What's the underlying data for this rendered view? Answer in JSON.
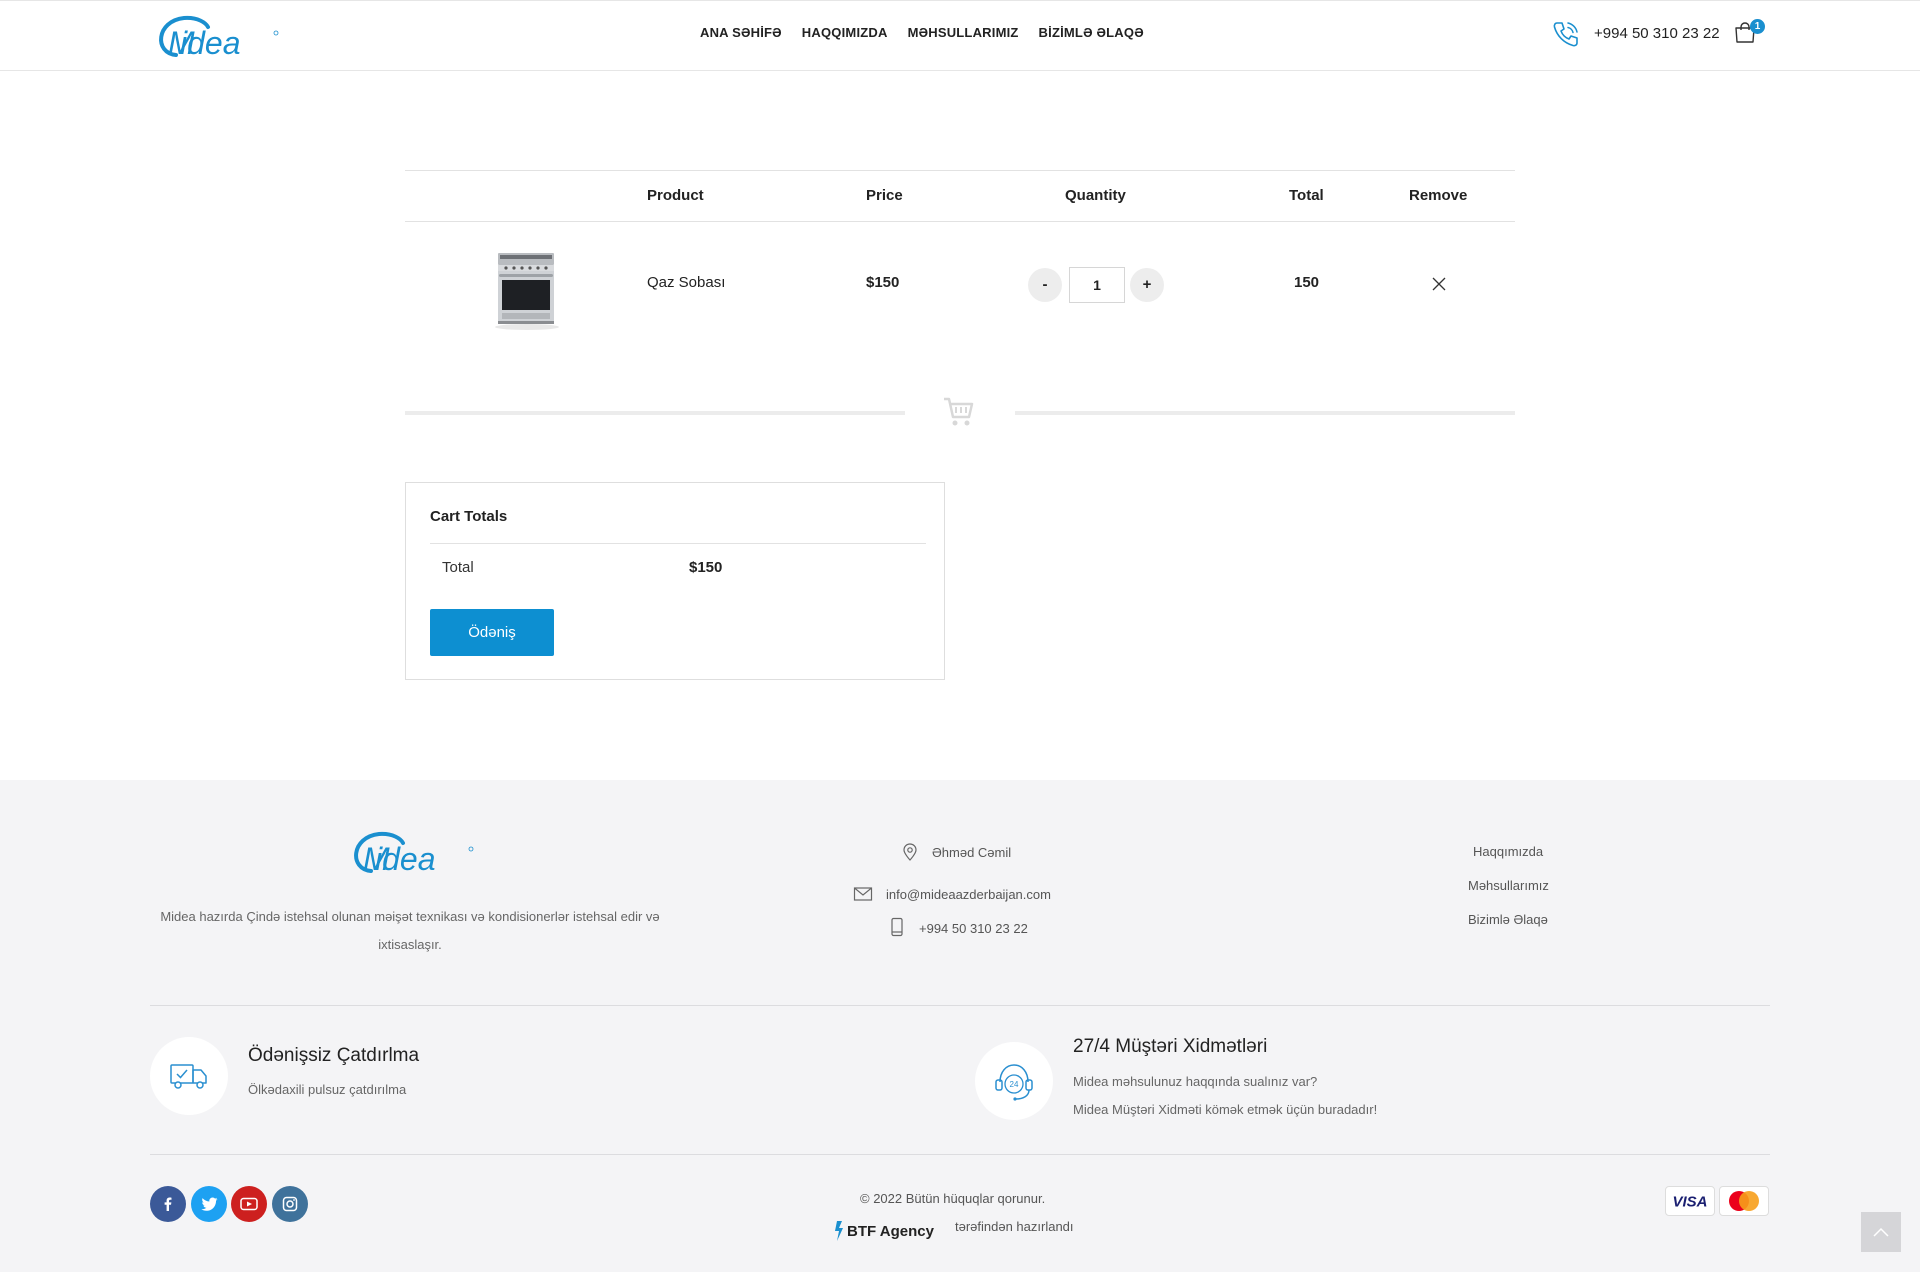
{
  "brand": {
    "name": "Midea",
    "accent": "#0d8fd1"
  },
  "nav": {
    "items": [
      {
        "label": "ANA SƏHİFƏ"
      },
      {
        "label": "HAQQIMIZDA"
      },
      {
        "label": "MƏHSULLARIMIZ"
      },
      {
        "label": "BİZİMLƏ ƏLAQƏ"
      }
    ],
    "phone": "+994 50 310 23 22",
    "cart_count": "1"
  },
  "cart": {
    "headers": {
      "product": "Product",
      "price": "Price",
      "quantity": "Quantity",
      "total": "Total",
      "remove": "Remove"
    },
    "items": [
      {
        "name": "Qaz Sobası",
        "price": "$150",
        "quantity": "1",
        "total": "150",
        "minus": "-",
        "plus": "+"
      }
    ]
  },
  "totals": {
    "title": "Cart Totals",
    "label": "Total",
    "value": "$150",
    "button": "Ödəniş"
  },
  "footer": {
    "description": "Midea hazırda Çində istehsal olunan məişət texnikası və kondisionerlər istehsal edir və ixtisaslaşır.",
    "address": "Əhməd Cəmil",
    "email": "info@mideaazderbaijan.com",
    "phone": "+994 50 310 23 22",
    "links": [
      {
        "label": "Haqqımızda"
      },
      {
        "label": "Məhsullarımız"
      },
      {
        "label": "Bizimlə Əlaqə"
      }
    ],
    "features": [
      {
        "title": "Ödənişsiz Çatdırlma",
        "text": "Ölkədaxili pulsuz çatdırılma"
      },
      {
        "title": "27/4 Müştəri Xidmətləri",
        "text1": "Midea məhsulunuz haqqında sualınız var?",
        "text2": "Midea Müştəri Xidməti kömək etmək üçün buradadır!"
      }
    ],
    "copyright": "© 2022 Bütün hüquqlar qorunur.",
    "agency": "BTF Agency",
    "made_by": "tərəfindən hazırlandı"
  }
}
